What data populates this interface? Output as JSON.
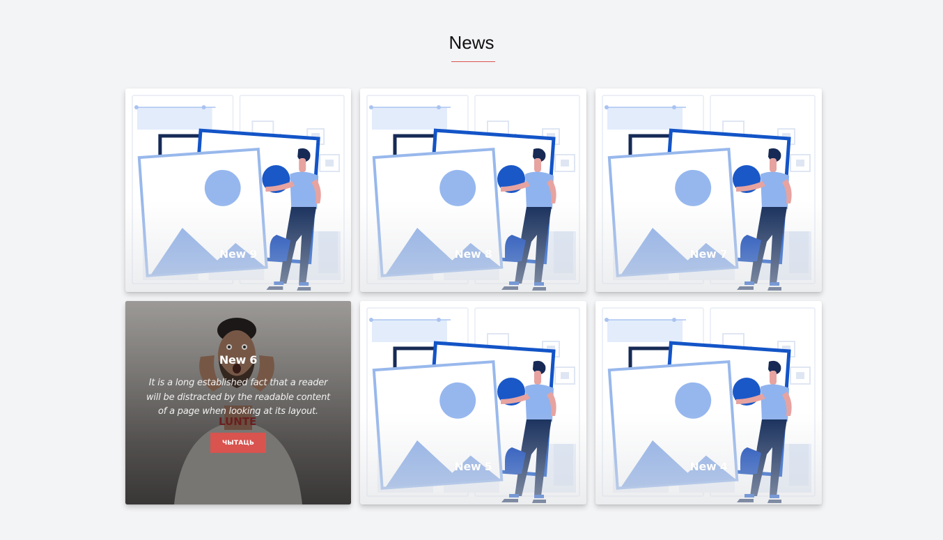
{
  "section": {
    "title": "News",
    "accent_color": "#d9534f"
  },
  "cards": [
    {
      "title": "New 9",
      "image": "illustration"
    },
    {
      "title": "New 8",
      "image": "illustration"
    },
    {
      "title": "New 7",
      "image": "illustration"
    },
    {
      "title": "New 6",
      "image": "photo",
      "hovered": true,
      "excerpt": "It is a long established fact that a reader will be distracted by the readable content of a page when looking at its layout.",
      "read_button_label": "ЧЫТАЦЬ",
      "photo_text": "LUNTE"
    },
    {
      "title": "New 5",
      "image": "illustration"
    },
    {
      "title": "New 4",
      "image": "illustration"
    }
  ],
  "icons": {
    "illustration": "image-gallery-illustration",
    "photo": "man-surprised-photo"
  }
}
